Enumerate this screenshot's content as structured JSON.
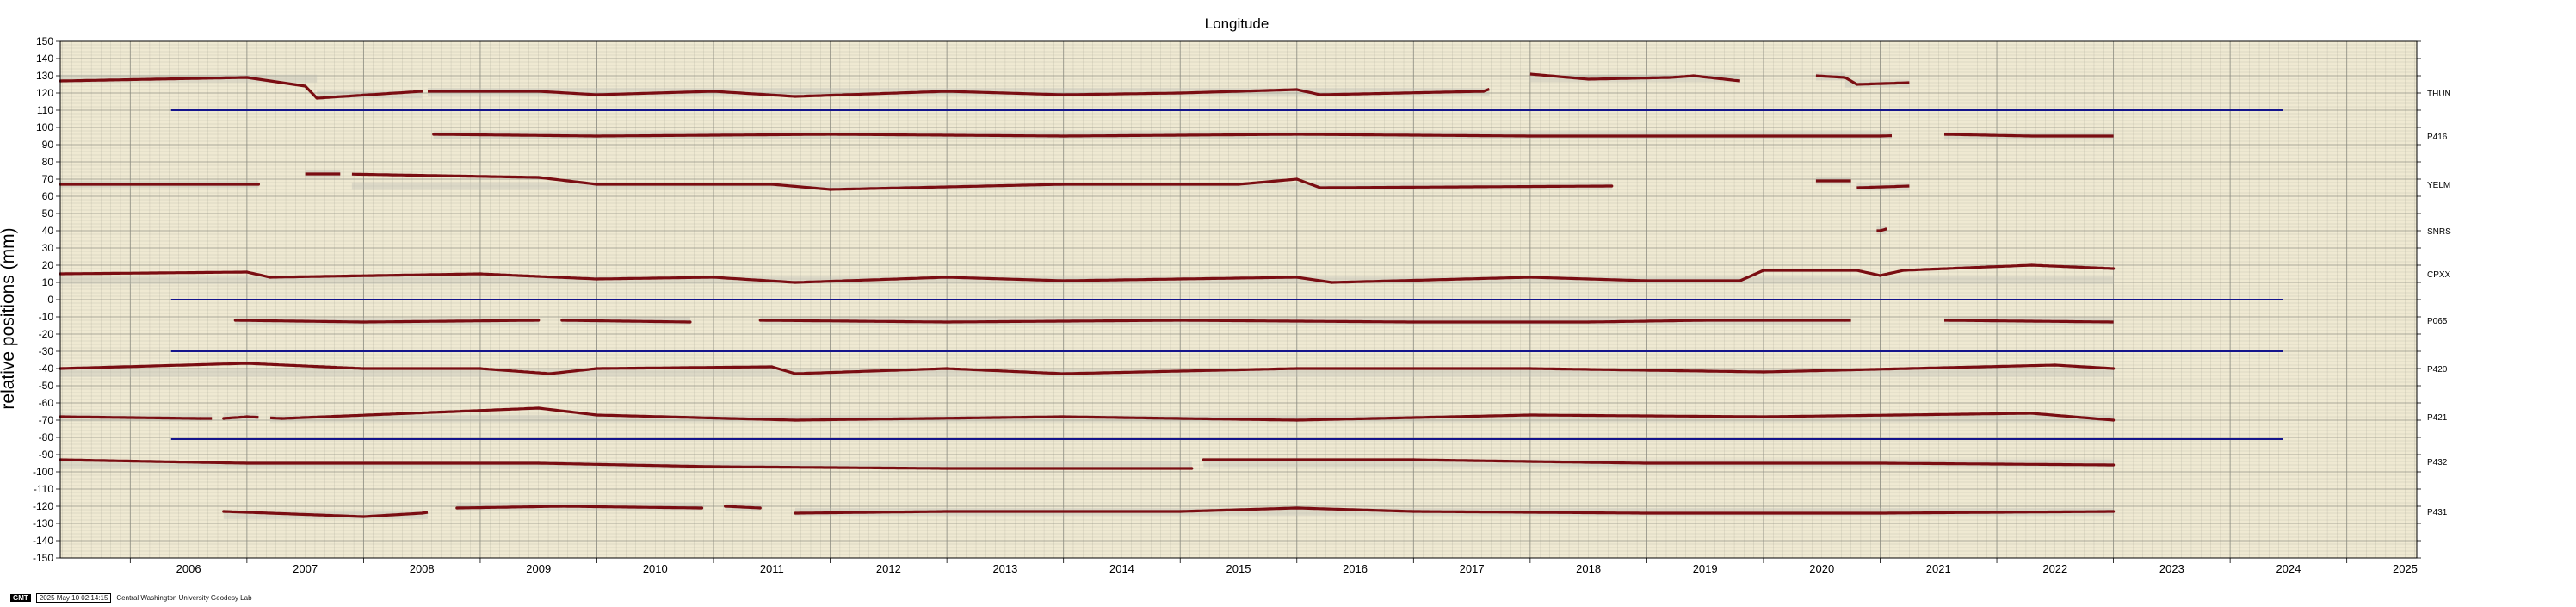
{
  "chart_data": {
    "type": "scatter",
    "title": "Longitude",
    "ylabel": "relative positions (mm)",
    "xlim": [
      2005.4,
      2025.6
    ],
    "ylim": [
      -150,
      150
    ],
    "x_ticks": [
      {
        "label": "2006",
        "x": 2006.0
      },
      {
        "label": "2007",
        "x": 2007.0
      },
      {
        "label": "2008",
        "x": 2008.0
      },
      {
        "label": "2009",
        "x": 2009.0
      },
      {
        "label": "2010",
        "x": 2010.0
      },
      {
        "label": "2011",
        "x": 2011.0
      },
      {
        "label": "2012",
        "x": 2012.0
      },
      {
        "label": "2013",
        "x": 2013.0
      },
      {
        "label": "2014",
        "x": 2014.0
      },
      {
        "label": "2015",
        "x": 2015.0
      },
      {
        "label": "2016",
        "x": 2016.0
      },
      {
        "label": "2017",
        "x": 2017.0
      },
      {
        "label": "2018",
        "x": 2018.0
      },
      {
        "label": "2019",
        "x": 2019.0
      },
      {
        "label": "2020",
        "x": 2020.0
      },
      {
        "label": "2021",
        "x": 2021.0
      },
      {
        "label": "2022",
        "x": 2022.0
      },
      {
        "label": "2023",
        "x": 2023.0
      },
      {
        "label": "2024",
        "x": 2024.0
      },
      {
        "label": "2025",
        "x": 2025.0
      }
    ],
    "y_ticks": [
      {
        "label": "150",
        "y": 150
      },
      {
        "label": "140",
        "y": 140
      },
      {
        "label": "130",
        "y": 130
      },
      {
        "label": "120",
        "y": 120
      },
      {
        "label": "110",
        "y": 110
      },
      {
        "label": "100",
        "y": 100
      },
      {
        "label": "90",
        "y": 90
      },
      {
        "label": "80",
        "y": 80
      },
      {
        "label": "70",
        "y": 70
      },
      {
        "label": "60",
        "y": 60
      },
      {
        "label": "50",
        "y": 50
      },
      {
        "label": "40",
        "y": 40
      },
      {
        "label": "30",
        "y": 30
      },
      {
        "label": "20",
        "y": 20
      },
      {
        "label": "10",
        "y": 10
      },
      {
        "label": "0",
        "y": 0
      },
      {
        "label": "-10",
        "y": -10
      },
      {
        "label": "-20",
        "y": -20
      },
      {
        "label": "-30",
        "y": -30
      },
      {
        "label": "-40",
        "y": -40
      },
      {
        "label": "-50",
        "y": -50
      },
      {
        "label": "-60",
        "y": -60
      },
      {
        "label": "-70",
        "y": -70
      },
      {
        "label": "-80",
        "y": -80
      },
      {
        "label": "-90",
        "y": -90
      },
      {
        "label": "-100",
        "y": -100
      },
      {
        "label": "-110",
        "y": -110
      },
      {
        "label": "-120",
        "y": -120
      },
      {
        "label": "-130",
        "y": -130
      },
      {
        "label": "-140",
        "y": -140
      },
      {
        "label": "-150",
        "y": -150
      }
    ],
    "grid": true,
    "colors": {
      "background": "#efe9d2",
      "grid": "#8b8b80",
      "points": "#7a0d12",
      "errorband": "#b9b9b2",
      "reference": "#14148c"
    },
    "series": [
      {
        "name": "THUN",
        "label_y": 120,
        "points": [
          [
            2005.4,
            127
          ],
          [
            2007.0,
            129
          ],
          [
            2007.5,
            124
          ],
          [
            2007.6,
            117
          ],
          [
            2008.5,
            121
          ],
          [
            2009.5,
            121
          ],
          [
            2010.0,
            119
          ],
          [
            2011.0,
            121
          ],
          [
            2011.7,
            118
          ],
          [
            2013.0,
            121
          ],
          [
            2014.0,
            119
          ],
          [
            2015.0,
            120
          ],
          [
            2016.0,
            122
          ],
          [
            2016.2,
            119
          ],
          [
            2017.6,
            121
          ]
        ],
        "segments": [
          [
            2005.4,
            2007.6
          ],
          [
            2007.6,
            2008.5
          ],
          [
            2008.55,
            2017.65
          ],
          [
            2018.0,
            2019.8
          ],
          [
            2020.45,
            2020.7
          ],
          [
            2020.7,
            2021.25
          ]
        ],
        "extra": [
          [
            2018.0,
            131
          ],
          [
            2018.5,
            128
          ],
          [
            2019.2,
            129
          ],
          [
            2019.4,
            130
          ],
          [
            2019.8,
            127
          ],
          [
            2020.45,
            130
          ],
          [
            2020.7,
            129
          ],
          [
            2020.8,
            125
          ],
          [
            2021.25,
            126
          ]
        ]
      },
      {
        "name": "P416",
        "label_y": 95,
        "points": [
          [
            2008.6,
            96
          ],
          [
            2010.0,
            95
          ],
          [
            2012.0,
            96
          ],
          [
            2014.0,
            95
          ],
          [
            2016.0,
            96
          ],
          [
            2018.0,
            95
          ],
          [
            2020.0,
            95
          ],
          [
            2021.0,
            95
          ]
        ],
        "segments": [
          [
            2008.6,
            2021.1
          ],
          [
            2021.55,
            2023.0
          ]
        ],
        "extra": [
          [
            2021.55,
            96
          ],
          [
            2022.3,
            95
          ],
          [
            2023.0,
            95
          ]
        ]
      },
      {
        "name": "YELM",
        "label_y": 67,
        "points": [
          [
            2005.4,
            67
          ],
          [
            2007.1,
            67
          ],
          [
            2009.5,
            71
          ],
          [
            2010.0,
            67
          ],
          [
            2011.5,
            67
          ],
          [
            2012.0,
            64
          ],
          [
            2014.0,
            67
          ],
          [
            2015.5,
            67
          ],
          [
            2016.0,
            70
          ],
          [
            2016.2,
            65
          ],
          [
            2018.7,
            66
          ]
        ],
        "segments": [
          [
            2005.4,
            2007.1
          ],
          [
            2007.5,
            2007.8
          ],
          [
            2007.9,
            2018.7
          ],
          [
            2020.45,
            2020.75
          ],
          [
            2020.8,
            2021.25
          ]
        ],
        "extra": [
          [
            2007.5,
            73
          ],
          [
            2007.8,
            73
          ],
          [
            2020.45,
            69
          ],
          [
            2020.75,
            69
          ],
          [
            2020.8,
            65
          ],
          [
            2021.25,
            66
          ]
        ]
      },
      {
        "name": "SNRS",
        "label_y": 40,
        "points": [
          [
            2021.0,
            40
          ],
          [
            2021.05,
            41
          ]
        ],
        "segments": [
          [
            2020.97,
            2021.05
          ]
        ],
        "extra": []
      },
      {
        "name": "CPXX",
        "label_y": 15,
        "points": [
          [
            2005.4,
            15
          ],
          [
            2007.0,
            16
          ],
          [
            2007.2,
            13
          ],
          [
            2009.0,
            15
          ],
          [
            2010.0,
            12
          ],
          [
            2011.0,
            13
          ],
          [
            2011.7,
            10
          ],
          [
            2013.0,
            13
          ],
          [
            2014.0,
            11
          ],
          [
            2016.0,
            13
          ],
          [
            2016.3,
            10
          ],
          [
            2018.0,
            13
          ],
          [
            2019.0,
            11
          ],
          [
            2019.8,
            11
          ],
          [
            2020.0,
            17
          ],
          [
            2020.8,
            17
          ],
          [
            2021.0,
            14
          ],
          [
            2021.2,
            17
          ],
          [
            2022.3,
            20
          ],
          [
            2023.0,
            18
          ]
        ],
        "segments": [
          [
            2005.4,
            2023.0
          ]
        ],
        "extra": []
      },
      {
        "name": "P065",
        "label_y": -12,
        "points": [
          [
            2006.9,
            -12
          ],
          [
            2008.0,
            -13
          ],
          [
            2009.5,
            -12
          ],
          [
            2009.7,
            -12
          ],
          [
            2010.8,
            -13
          ],
          [
            2011.4,
            -12
          ],
          [
            2013.0,
            -13
          ],
          [
            2015.0,
            -12
          ],
          [
            2017.0,
            -13
          ],
          [
            2018.5,
            -13
          ],
          [
            2019.5,
            -12
          ],
          [
            2020.7,
            -12
          ]
        ],
        "segments": [
          [
            2006.9,
            2009.5
          ],
          [
            2009.7,
            2010.8
          ],
          [
            2011.4,
            2020.75
          ],
          [
            2021.55,
            2023.0
          ]
        ],
        "extra": [
          [
            2021.55,
            -12
          ],
          [
            2023.0,
            -13
          ]
        ]
      },
      {
        "name": "P420",
        "label_y": -40,
        "points": [
          [
            2005.4,
            -40
          ],
          [
            2007.0,
            -37
          ],
          [
            2008.0,
            -40
          ],
          [
            2009.0,
            -40
          ],
          [
            2009.6,
            -43
          ],
          [
            2010.0,
            -40
          ],
          [
            2011.5,
            -39
          ],
          [
            2011.7,
            -43
          ],
          [
            2013.0,
            -40
          ],
          [
            2014.0,
            -43
          ],
          [
            2016.0,
            -40
          ],
          [
            2018.0,
            -40
          ],
          [
            2020.0,
            -42
          ],
          [
            2022.5,
            -38
          ],
          [
            2023.0,
            -40
          ]
        ],
        "segments": [
          [
            2005.4,
            2023.0
          ]
        ],
        "extra": []
      },
      {
        "name": "P421",
        "label_y": -68,
        "points": [
          [
            2005.4,
            -68
          ],
          [
            2006.6,
            -69
          ],
          [
            2006.8,
            -69
          ],
          [
            2007.0,
            -68
          ],
          [
            2007.3,
            -69
          ],
          [
            2009.5,
            -63
          ],
          [
            2010.0,
            -67
          ],
          [
            2011.7,
            -70
          ],
          [
            2014.0,
            -68
          ],
          [
            2016.0,
            -70
          ],
          [
            2018.0,
            -67
          ],
          [
            2020.0,
            -68
          ],
          [
            2022.3,
            -66
          ],
          [
            2023.0,
            -70
          ]
        ],
        "segments": [
          [
            2005.4,
            2006.7
          ],
          [
            2006.8,
            2007.1
          ],
          [
            2007.2,
            2023.0
          ]
        ],
        "extra": []
      },
      {
        "name": "P432",
        "label_y": -94,
        "points": [
          [
            2005.4,
            -93
          ],
          [
            2007.0,
            -95
          ],
          [
            2009.5,
            -95
          ],
          [
            2011.0,
            -97
          ],
          [
            2013.0,
            -98
          ],
          [
            2015.1,
            -98
          ],
          [
            2015.2,
            -93
          ],
          [
            2017.0,
            -93
          ],
          [
            2019.0,
            -95
          ],
          [
            2021.0,
            -95
          ],
          [
            2023.0,
            -96
          ]
        ],
        "segments": [
          [
            2005.4,
            2015.1
          ],
          [
            2015.2,
            2023.0
          ]
        ],
        "extra": []
      },
      {
        "name": "P431",
        "label_y": -123,
        "points": [
          [
            2006.8,
            -123
          ],
          [
            2008.0,
            -126
          ],
          [
            2008.5,
            -124
          ],
          [
            2008.8,
            -121
          ],
          [
            2009.7,
            -120
          ],
          [
            2010.9,
            -121
          ],
          [
            2011.1,
            -120
          ],
          [
            2011.4,
            -121
          ],
          [
            2011.7,
            -124
          ],
          [
            2013.0,
            -123
          ],
          [
            2015.0,
            -123
          ],
          [
            2016.0,
            -121
          ],
          [
            2017.0,
            -123
          ],
          [
            2019.0,
            -124
          ],
          [
            2021.0,
            -124
          ],
          [
            2023.0,
            -123
          ]
        ],
        "segments": [
          [
            2006.8,
            2008.55
          ],
          [
            2008.8,
            2010.9
          ],
          [
            2011.1,
            2011.4
          ],
          [
            2011.7,
            2023.0
          ]
        ],
        "extra": []
      }
    ],
    "reference_lines": [
      {
        "y": 110,
        "x_start": 2006.35,
        "x_end": 2024.45
      },
      {
        "y": 0,
        "x_start": 2006.35,
        "x_end": 2024.45
      },
      {
        "y": -30,
        "x_start": 2006.35,
        "x_end": 2024.45
      },
      {
        "y": -81,
        "x_start": 2006.35,
        "x_end": 2024.45
      }
    ]
  },
  "footer": {
    "logo": "GMT",
    "timestamp": "2025 May 10 02:14:15",
    "credit": "Central Washington University Geodesy Lab"
  }
}
